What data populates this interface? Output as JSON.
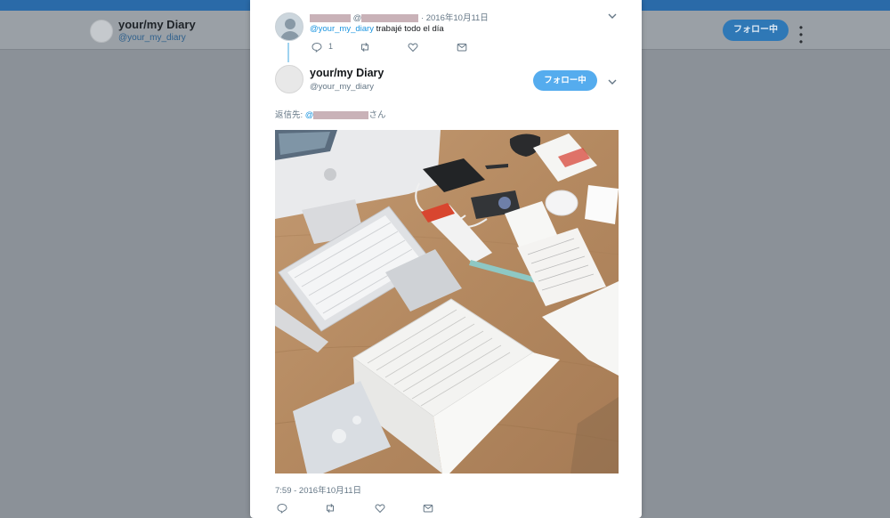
{
  "background": {
    "profile_name": "your/my Diary",
    "profile_handle": "@your_my_diary",
    "follow_button": "フォロー中",
    "more_icon": "vertical-dots-icon"
  },
  "parent_tweet": {
    "meta_at": "@",
    "date": "· 2016年10月11日",
    "mention": "@your_my_diary",
    "text": " trabajé todo el día",
    "reply_count": "1",
    "icons": [
      "reply-icon",
      "retweet-icon",
      "like-icon",
      "message-icon",
      "chevron-down-icon"
    ]
  },
  "main_tweet": {
    "name": "your/my Diary",
    "handle": "@your_my_diary",
    "follow_button": "フォロー中",
    "replying_prefix": "返信先: ",
    "replying_at": "@",
    "replying_suffix": "さん",
    "timestamp": "7:59 - 2016年10月11日",
    "photo_icon": "desk-photo",
    "icons": [
      "reply-icon",
      "retweet-icon",
      "like-icon",
      "message-icon",
      "chevron-down-icon"
    ]
  },
  "colors": {
    "accent": "#55acee",
    "link": "#1b95e0",
    "muted": "#657786",
    "overlay": "#8a9098",
    "topbar": "#2a6aa8"
  }
}
